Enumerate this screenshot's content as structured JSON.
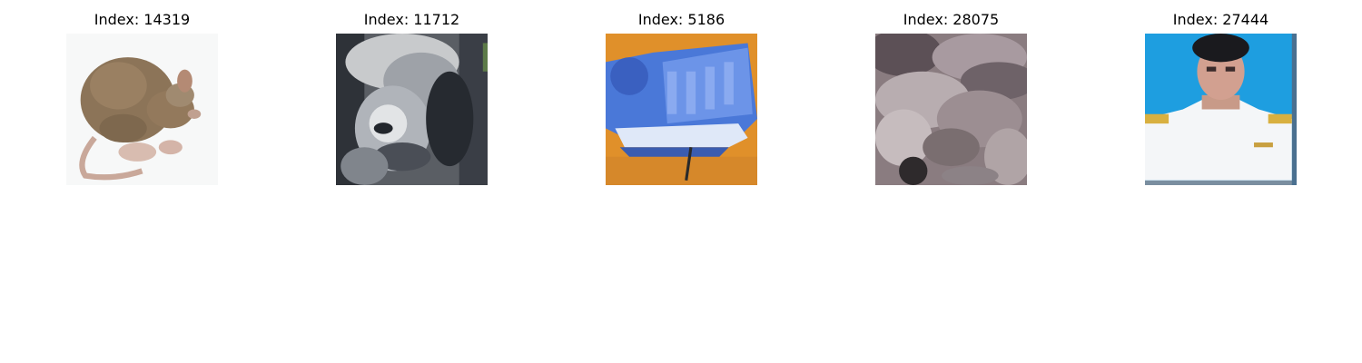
{
  "panels": [
    {
      "title": "Index: 14319",
      "subject": "mouse"
    },
    {
      "title": "Index: 11712",
      "subject": "chimpanzee"
    },
    {
      "title": "Index: 5186",
      "subject": "telephone"
    },
    {
      "title": "Index: 28075",
      "subject": "animals-blurry"
    },
    {
      "title": "Index: 27444",
      "subject": "man-in-uniform"
    }
  ]
}
